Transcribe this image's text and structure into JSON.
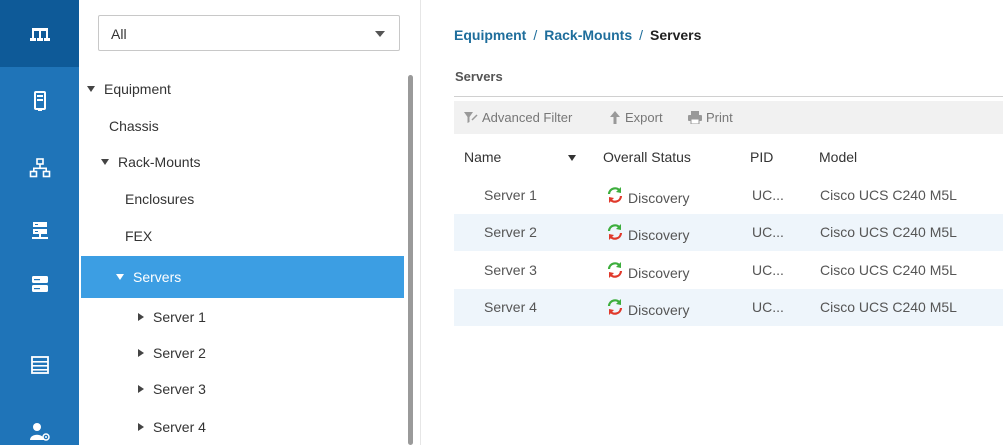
{
  "rail": {
    "items": [
      {
        "icon": "network-tree-icon",
        "active": true
      },
      {
        "icon": "server-box-icon",
        "active": false
      },
      {
        "icon": "topology-icon",
        "active": false
      },
      {
        "icon": "rack-server-icon",
        "active": false
      },
      {
        "icon": "storage-stack-icon",
        "active": false
      },
      {
        "icon": "list-lines-icon",
        "active": false
      },
      {
        "icon": "admin-user-gear-icon",
        "active": false
      }
    ]
  },
  "nav": {
    "filter": {
      "selected": "All"
    },
    "tree": [
      {
        "label": "Equipment",
        "expander": "expanded"
      },
      {
        "label": "Chassis",
        "expander": "none"
      },
      {
        "label": "Rack-Mounts",
        "expander": "expanded"
      },
      {
        "label": "Enclosures",
        "expander": "none"
      },
      {
        "label": "FEX",
        "expander": "none"
      },
      {
        "label": "Servers",
        "expander": "expanded",
        "selected": true
      },
      {
        "label": "Server 1",
        "expander": "collapsed"
      },
      {
        "label": "Server 2",
        "expander": "collapsed"
      },
      {
        "label": "Server 3",
        "expander": "collapsed"
      },
      {
        "label": "Server 4",
        "expander": "collapsed"
      }
    ]
  },
  "breadcrumb": {
    "items": [
      "Equipment",
      "Rack-Mounts"
    ],
    "separator": "/",
    "current": "Servers"
  },
  "section": {
    "title": "Servers"
  },
  "toolbar": {
    "advanced_filter": "Advanced Filter",
    "export": "Export",
    "print": "Print"
  },
  "table": {
    "columns": {
      "name": "Name",
      "status": "Overall Status",
      "pid": "PID",
      "model": "Model"
    },
    "rows": [
      {
        "name": "Server 1",
        "status": "Discovery",
        "pid": "UC...",
        "model": "Cisco UCS C240 M5L"
      },
      {
        "name": "Server 2",
        "status": "Discovery",
        "pid": "UC...",
        "model": "Cisco UCS C240 M5L"
      },
      {
        "name": "Server 3",
        "status": "Discovery",
        "pid": "UC...",
        "model": "Cisco UCS C240 M5L"
      },
      {
        "name": "Server 4",
        "status": "Discovery",
        "pid": "UC...",
        "model": "Cisco UCS C240 M5L"
      }
    ]
  },
  "colors": {
    "rail_bg": "#1f74b8",
    "rail_active": "#0e5a98",
    "selected_row": "#3c9ee3",
    "breadcrumb_link": "#1f6e9c",
    "status_green": "#3dae3d",
    "status_red": "#e0392b",
    "row_alt": "#eef5fb"
  }
}
